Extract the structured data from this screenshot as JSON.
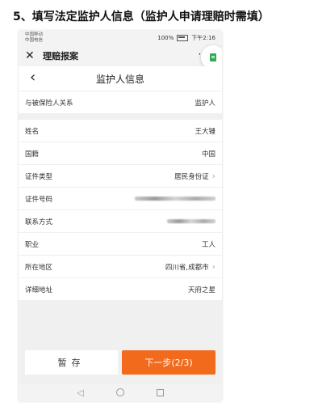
{
  "doc": {
    "heading": "5、填写法定监护人信息（监护人申请理赔时需填）"
  },
  "status": {
    "carrier_line1": "中国移动",
    "carrier_line2": "中国电信",
    "battery": "100%",
    "time": "下午2:16"
  },
  "app": {
    "title": "理赔报案",
    "more": "···"
  },
  "page": {
    "title": "监护人信息"
  },
  "rows": [
    {
      "label": "与被保险人关系",
      "value": "监护人"
    },
    {
      "label": "姓名",
      "value": "王大锤"
    },
    {
      "label": "国籍",
      "value": "中国"
    },
    {
      "label": "证件类型",
      "value": "居民身份证"
    },
    {
      "label": "证件号码",
      "value": ""
    },
    {
      "label": "联系方式",
      "value": ""
    },
    {
      "label": "职业",
      "value": "工人"
    },
    {
      "label": "所在地区",
      "value": "四川省,成都市"
    },
    {
      "label": "详细地址",
      "value": "天府之星"
    }
  ],
  "footer": {
    "save": "暂存",
    "next": "下一步(2/3)"
  },
  "colors": {
    "accent": "#f26a1b"
  },
  "icons": {
    "close": "close-icon",
    "back": "chevron-left-icon",
    "float": "document-icon"
  }
}
